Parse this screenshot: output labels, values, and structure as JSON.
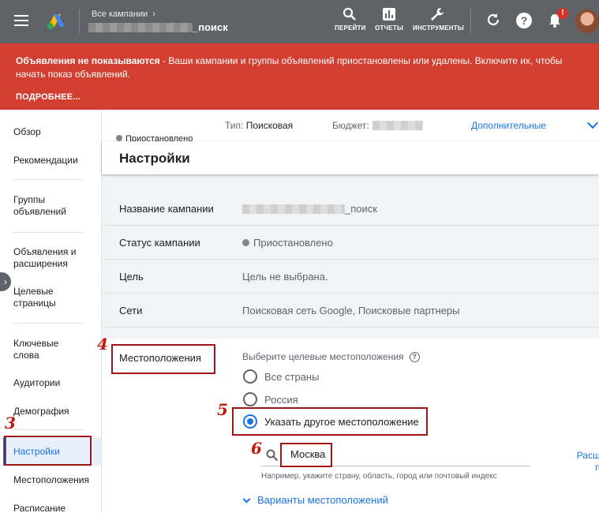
{
  "header": {
    "menu_icon": "hamburger-menu-icon",
    "logo": "google-ads-logo",
    "breadcrumb": "Все кампании",
    "campaign_suffix": "_поиск",
    "buttons": [
      {
        "label": "ПЕРЕЙТИ",
        "icon": "search-icon"
      },
      {
        "label": "ОТЧЕТЫ",
        "icon": "reports-icon"
      },
      {
        "label": "ИНСТРУМЕНТЫ",
        "icon": "wrench-icon"
      }
    ],
    "notification_badge": "!"
  },
  "banner": {
    "title": "Объявления не показываются",
    "text": " - Ваши кампании и группы объявлений приостановлены или удалены. Включите их, чтобы начать показ объявлений.",
    "link": "ПОДРОБНЕЕ...",
    "color": "#d23f31"
  },
  "sidebar": {
    "items": [
      {
        "label": "Обзор"
      },
      {
        "label": "Рекомендации"
      },
      {
        "label": "Группы объявлений"
      },
      {
        "label": "Объявления и расширения"
      },
      {
        "label": "Целевые страницы"
      },
      {
        "label": "Ключевые слова"
      },
      {
        "label": "Аудитории"
      },
      {
        "label": "Демография"
      },
      {
        "label": "Настройки"
      },
      {
        "label": "Местоположения"
      },
      {
        "label": "Расписание"
      }
    ],
    "active_label": "Настройки"
  },
  "summary": {
    "status": "Приостановлено",
    "type_label": "Тип:",
    "type_value": "Поисковая",
    "budget_label": "Бюджет:",
    "more_link": "Дополнительные"
  },
  "settings": {
    "title": "Настройки",
    "rows": [
      {
        "label": "Название кампании",
        "value": "_поиск"
      },
      {
        "label": "Статус кампании",
        "value": "Приостановлено"
      },
      {
        "label": "Цель",
        "value": "Цель не выбрана."
      },
      {
        "label": "Сети",
        "value": "Поисковая сеть Google, Поисковые партнеры"
      }
    ],
    "locations": {
      "label": "Местоположения",
      "hint": "Выберите целевые местоположения",
      "options": [
        {
          "label": "Все страны",
          "checked": false
        },
        {
          "label": "Россия",
          "checked": false
        },
        {
          "label": "Указать другое местоположение",
          "checked": true
        }
      ],
      "search_value": "Москва",
      "search_help": "Например, укажите страну, область, город или почтовый индекс",
      "advanced_link_line1": "Расшир",
      "advanced_link_line2": "пои",
      "variants_link": "Варианты местоположений"
    }
  },
  "annotations": [
    "3",
    "4",
    "5",
    "6"
  ],
  "accent_color": "#1a73e8",
  "annotation_color": "#a31515"
}
